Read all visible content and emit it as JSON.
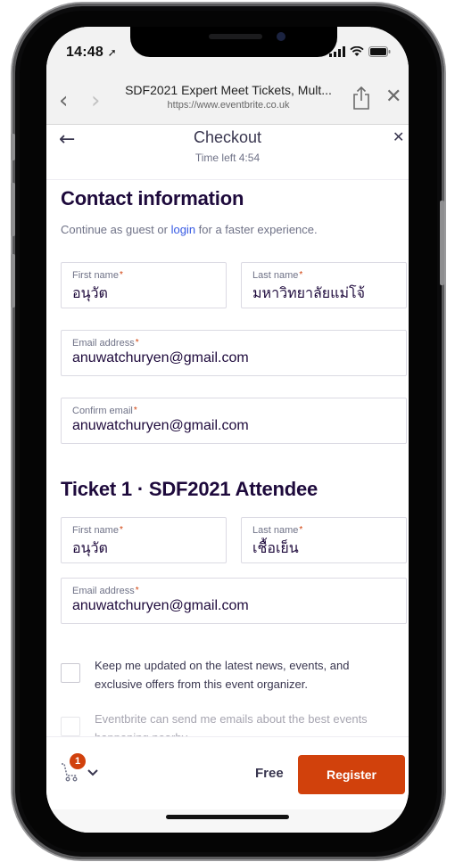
{
  "status": {
    "time": "14:48"
  },
  "browser": {
    "page_title": "SDF2021 Expert Meet Tickets, Mult...",
    "url": "https://www.eventbrite.co.uk"
  },
  "checkout": {
    "title": "Checkout",
    "time_left": "Time left 4:54"
  },
  "contact": {
    "heading": "Contact information",
    "guest_prefix": "Continue as guest or ",
    "login_link": "login",
    "guest_suffix": " for a faster experience.",
    "first_name_label": "First name",
    "first_name_value": "อนุวัต",
    "last_name_label": "Last name",
    "last_name_value": "มหาวิทยาลัยแม่โจ้",
    "email_label": "Email address",
    "email_value": "anuwatchuryen@gmail.com",
    "confirm_label": "Confirm email",
    "confirm_value": "anuwatchuryen@gmail.com"
  },
  "ticket": {
    "heading": "Ticket 1 · SDF2021 Attendee",
    "first_name_label": "First name",
    "first_name_value": "อนุวัต",
    "last_name_label": "Last name",
    "last_name_value": "เชื้อเย็น",
    "email_label": "Email address",
    "email_value": "anuwatchuryen@gmail.com"
  },
  "options": [
    {
      "text": "Keep me updated on the latest news, events, and exclusive offers from this event organizer.",
      "checked": false
    },
    {
      "text": "Eventbrite can send me emails about the best events happening nearby.",
      "checked": false
    }
  ],
  "footer": {
    "cart_count": "1",
    "price": "Free",
    "register_label": "Register"
  },
  "colors": {
    "brand_orange": "#d1410c",
    "link_blue": "#3659e3",
    "heading_text": "#1e0a3c"
  }
}
